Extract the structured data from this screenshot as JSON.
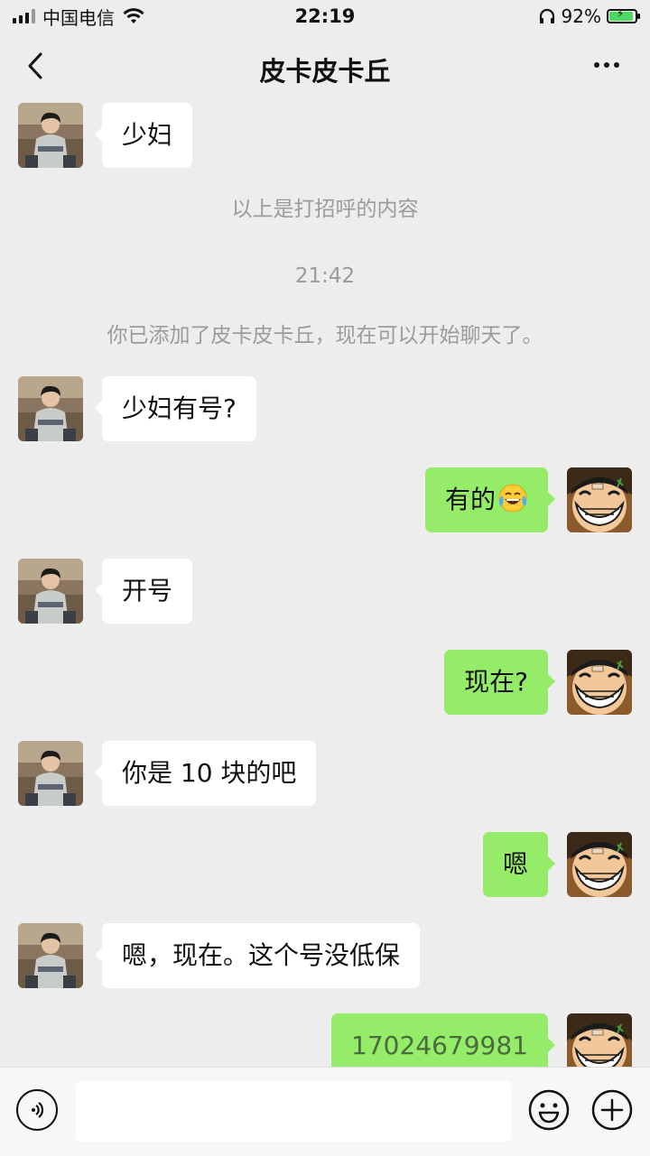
{
  "status_bar": {
    "carrier": "中国电信",
    "time": "22:19",
    "battery": "92%",
    "battery_level": 0.92
  },
  "nav": {
    "title": "皮卡皮卡丘",
    "back_icon": "chevron-left-icon",
    "more_icon": "more-dots-icon"
  },
  "messages": {
    "m1": {
      "text": "少妇"
    },
    "sys1": {
      "text": "以上是打招呼的内容"
    },
    "time1": {
      "text": "21:42"
    },
    "sys2": {
      "text": "你已添加了皮卡皮卡丘，现在可以开始聊天了。"
    },
    "m2": {
      "text": "少妇有号?"
    },
    "m3": {
      "text": "有的",
      "emoji": "tears-of-joy-emoji"
    },
    "m4": {
      "text": "开号"
    },
    "m5": {
      "text": "现在?"
    },
    "m6": {
      "text": "你是 10 块的吧"
    },
    "m7": {
      "text": "嗯"
    },
    "m8": {
      "text": "嗯，现在。这个号没低保"
    },
    "m9": {
      "text": "17024679981"
    }
  },
  "input_bar": {
    "value": "",
    "placeholder": "",
    "voice_icon": "voice-icon",
    "emoji_icon": "emoji-icon",
    "plus_icon": "plus-icon"
  },
  "colors": {
    "background": "#ededed",
    "bubble_out": "#95ec69",
    "bubble_in": "#ffffff",
    "system_text": "#9b9b9b"
  }
}
